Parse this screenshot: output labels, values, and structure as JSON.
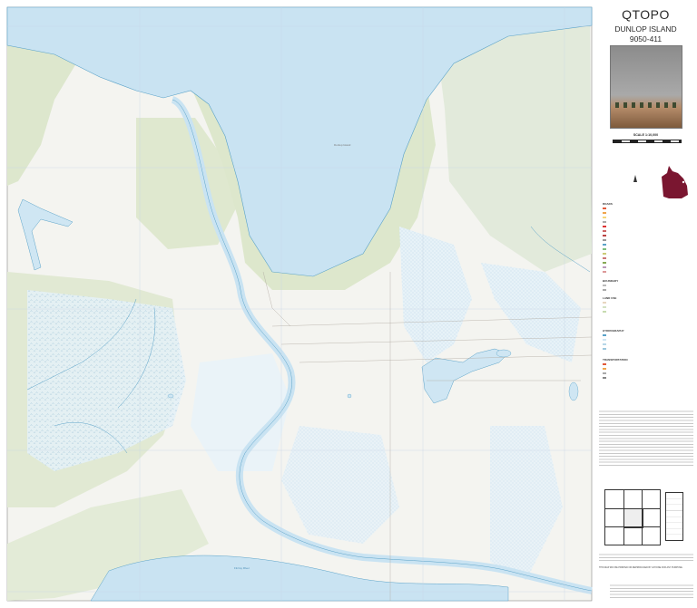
{
  "header": {
    "brand": "QTOPO",
    "sheet_name": "DUNLOP ISLAND",
    "sheet_number": "9050-411"
  },
  "scale": {
    "label": "SCALE 1:10,000"
  },
  "legend": {
    "sections": [
      "ROADS",
      "BOUNDARY",
      "LAND USE",
      "HYDROGRAPHY",
      "TRANSPORTATION"
    ]
  },
  "disclaimer": {
    "footer_notice": "THIS MAP MAY BE PRINTED OR REPRODUCED BY ANYONE FOR ANY PURPOSE."
  },
  "colors": {
    "land": "#f3f3ef",
    "veg": "#dfe8cf",
    "water": "#cfe6f3",
    "water_edge": "#5aa2c8",
    "river": "#c9e3f2",
    "wetland": "#b7d7e8",
    "grid": "#cfd9e6",
    "maroon": "#7a1630"
  },
  "map": {
    "labels": [
      "Dunlop Island",
      "Fitzroy River"
    ]
  }
}
